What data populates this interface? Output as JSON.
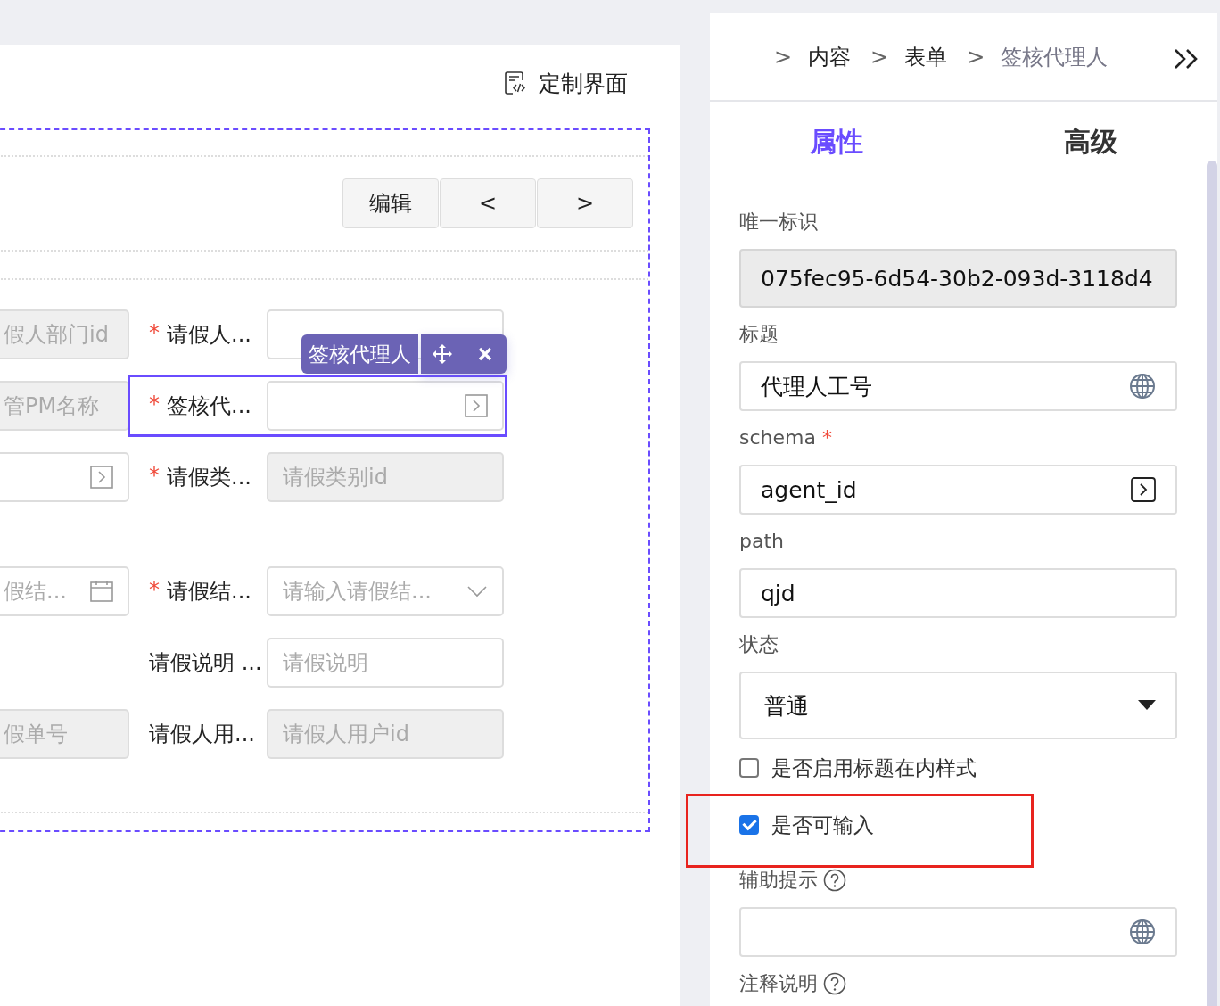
{
  "canvas": {
    "customize_button": "定制界面",
    "pager_buttons": [
      "编辑",
      "<",
      ">"
    ],
    "toolbar_label": "签核代理人",
    "rows": [
      {
        "left": {
          "placeholder": "假人部门id",
          "disabled": true,
          "kind": "text"
        },
        "field": {
          "label": "请假人...",
          "mark": "*",
          "disabled": false,
          "kind": "text",
          "selected": false
        }
      },
      {
        "left": {
          "placeholder": "管PM名称",
          "disabled": true,
          "kind": "text"
        },
        "field": {
          "label": "签核代...",
          "mark": "*",
          "disabled": false,
          "kind": "picker",
          "selected": true
        }
      },
      {
        "left": {
          "disabled": false,
          "kind": "picker"
        },
        "field": {
          "label": "请假类...",
          "mark": "*",
          "placeholder": "请假类别id",
          "disabled": true,
          "kind": "text",
          "selected": false
        }
      },
      {
        "left": {
          "placeholder": "假结...",
          "disabled": false,
          "kind": "date"
        },
        "field": {
          "label": "请假结...",
          "mark": "*",
          "placeholder": "请输入请假结...",
          "disabled": false,
          "kind": "select",
          "selected": false
        }
      },
      {
        "field": {
          "label": "请假说明 ...",
          "placeholder": "请假说明",
          "disabled": false,
          "kind": "text",
          "selected": false
        }
      },
      {
        "left": {
          "placeholder": "假单号",
          "disabled": true,
          "kind": "text"
        },
        "field": {
          "label": "请假人用...",
          "placeholder": "请假人用户id",
          "disabled": true,
          "kind": "text",
          "selected": false
        }
      }
    ]
  },
  "panel": {
    "breadcrumb": [
      {
        "sep": ">",
        "label": "内容",
        "current": false
      },
      {
        "sep": ">",
        "label": "表单",
        "current": false
      },
      {
        "sep": ">",
        "label": "签核代理人",
        "current": true
      }
    ],
    "tabs": [
      {
        "label": "属性",
        "selected": true
      },
      {
        "label": "高级",
        "selected": false
      }
    ],
    "properties": [
      {
        "kind": "input",
        "label": "唯一标识",
        "value": "075fec95-6d54-30b2-093d-3118d4",
        "disabled": true
      },
      {
        "kind": "i18n",
        "label": "标题",
        "value": "代理人工号"
      },
      {
        "kind": "picker",
        "label": "schema",
        "mark": "*",
        "value": "agent_id"
      },
      {
        "kind": "input",
        "label": "path",
        "value": "qjd"
      },
      {
        "kind": "select",
        "label": "状态",
        "value": "普通"
      },
      {
        "kind": "checkbox",
        "label": "是否启用标题在内样式",
        "checked": false,
        "highlighted": false
      },
      {
        "kind": "checkbox",
        "label": "是否可输入",
        "checked": true,
        "highlighted": true
      },
      {
        "kind": "i18n",
        "label": "辅助提示",
        "help": true
      },
      {
        "kind": "heading",
        "label": "注释说明",
        "help": true
      }
    ]
  }
}
